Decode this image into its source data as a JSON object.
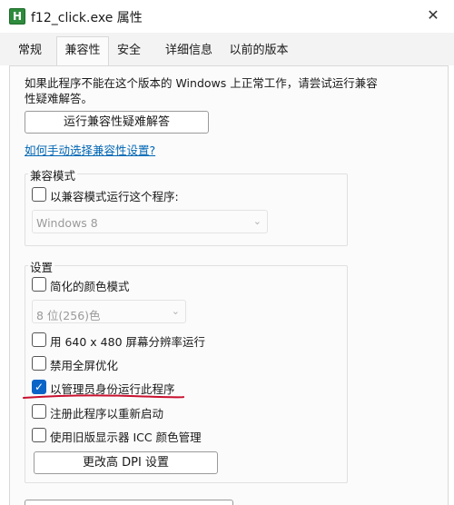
{
  "window": {
    "icon_letter": "H",
    "title": "f12_click.exe 属性",
    "close_glyph": "✕"
  },
  "tabs": [
    {
      "label": "常规"
    },
    {
      "label": "兼容性"
    },
    {
      "label": "安全"
    },
    {
      "label": "详细信息"
    },
    {
      "label": "以前的版本"
    }
  ],
  "active_tab": "兼容性",
  "compat": {
    "intro": "如果此程序不能在这个版本的 Windows 上正常工作，请尝试运行兼容性疑难解答。",
    "troubleshoot_button": "运行兼容性疑难解答",
    "manual_link": "如何手动选择兼容性设置?",
    "mode_group": {
      "title": "兼容模式",
      "checkbox_label": "以兼容模式运行这个程序:",
      "checked": false,
      "os_select": "Windows 8"
    },
    "settings_group": {
      "title": "设置",
      "reduced_color": {
        "label": "简化的颜色模式",
        "checked": false
      },
      "color_select": "8 位(256)色",
      "res_640": {
        "label": "用 640 x 480 屏幕分辨率运行",
        "checked": false
      },
      "disable_fullscreen": {
        "label": "禁用全屏优化",
        "checked": false
      },
      "run_as_admin": {
        "label": "以管理员身份运行此程序",
        "checked": true
      },
      "register_restart": {
        "label": "注册此程序以重新启动",
        "checked": false
      },
      "legacy_icc": {
        "label": "使用旧版显示器 ICC 颜色管理",
        "checked": false
      },
      "dpi_button": "更改高 DPI 设置"
    }
  },
  "colors": {
    "accent": "#0a64c8",
    "link": "#0066b4",
    "annotation": "#c8102e",
    "app_icon": "#2e8b3c"
  },
  "icons": {
    "app": "app-icon",
    "close": "close-icon",
    "check": "checkmark-icon",
    "chevron": "chevron-down-icon"
  }
}
